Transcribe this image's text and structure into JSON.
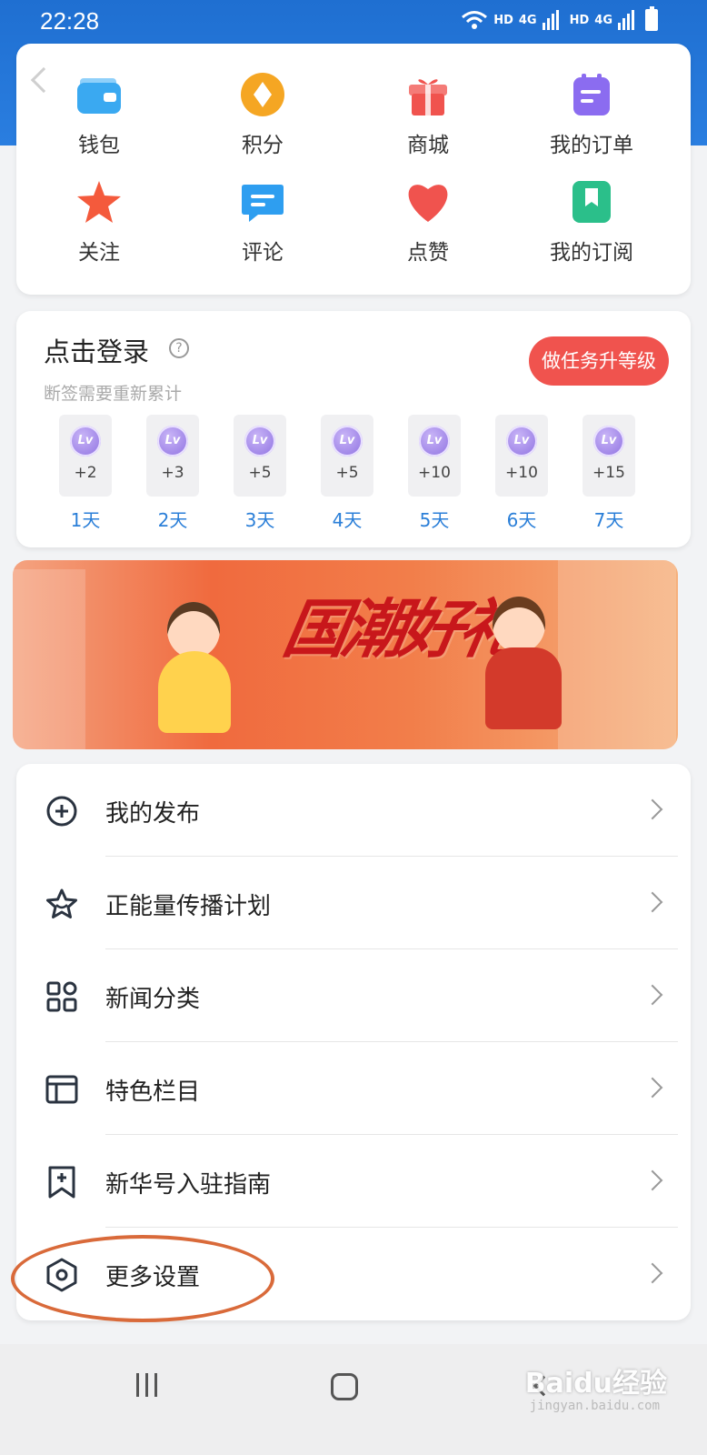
{
  "status": {
    "time": "22:28",
    "net1": "HD",
    "net2": "HD",
    "gen1": "4G",
    "gen2": "4G"
  },
  "quick_grid": [
    {
      "label": "钱包",
      "icon": "wallet-icon",
      "color": "#3aa9f1"
    },
    {
      "label": "积分",
      "icon": "points-icon",
      "color": "#f5a623"
    },
    {
      "label": "商城",
      "icon": "gift-icon",
      "color": "#f0534e"
    },
    {
      "label": "我的订单",
      "icon": "order-icon",
      "color": "#8b6cf0"
    },
    {
      "label": "关注",
      "icon": "star-icon",
      "color": "#f45a3c"
    },
    {
      "label": "评论",
      "icon": "comment-icon",
      "color": "#2e9ef0"
    },
    {
      "label": "点赞",
      "icon": "heart-icon",
      "color": "#f0534e"
    },
    {
      "label": "我的订阅",
      "icon": "bookmark-icon",
      "color": "#2bbf8a"
    }
  ],
  "sign_in": {
    "title": "点击登录",
    "subtitle": "断签需要重新累计",
    "task_button": "做任务升等级",
    "badge_text": "Lv",
    "days": [
      {
        "points": "+2",
        "label": "1天"
      },
      {
        "points": "+3",
        "label": "2天"
      },
      {
        "points": "+5",
        "label": "3天"
      },
      {
        "points": "+5",
        "label": "4天"
      },
      {
        "points": "+10",
        "label": "5天"
      },
      {
        "points": "+10",
        "label": "6天"
      },
      {
        "points": "+15",
        "label": "7天"
      }
    ]
  },
  "banner": {
    "slogan": "国潮好礼"
  },
  "menu": [
    {
      "label": "我的发布",
      "icon": "plus-circle-icon"
    },
    {
      "label": "正能量传播计划",
      "icon": "star-outline-icon"
    },
    {
      "label": "新闻分类",
      "icon": "grid-icon"
    },
    {
      "label": "特色栏目",
      "icon": "table-icon"
    },
    {
      "label": "新华号入驻指南",
      "icon": "bookmark-plus-icon"
    },
    {
      "label": "更多设置",
      "icon": "settings-hex-icon"
    }
  ],
  "watermark": {
    "brand": "Baidu经验",
    "url": "jingyan.baidu.com"
  }
}
